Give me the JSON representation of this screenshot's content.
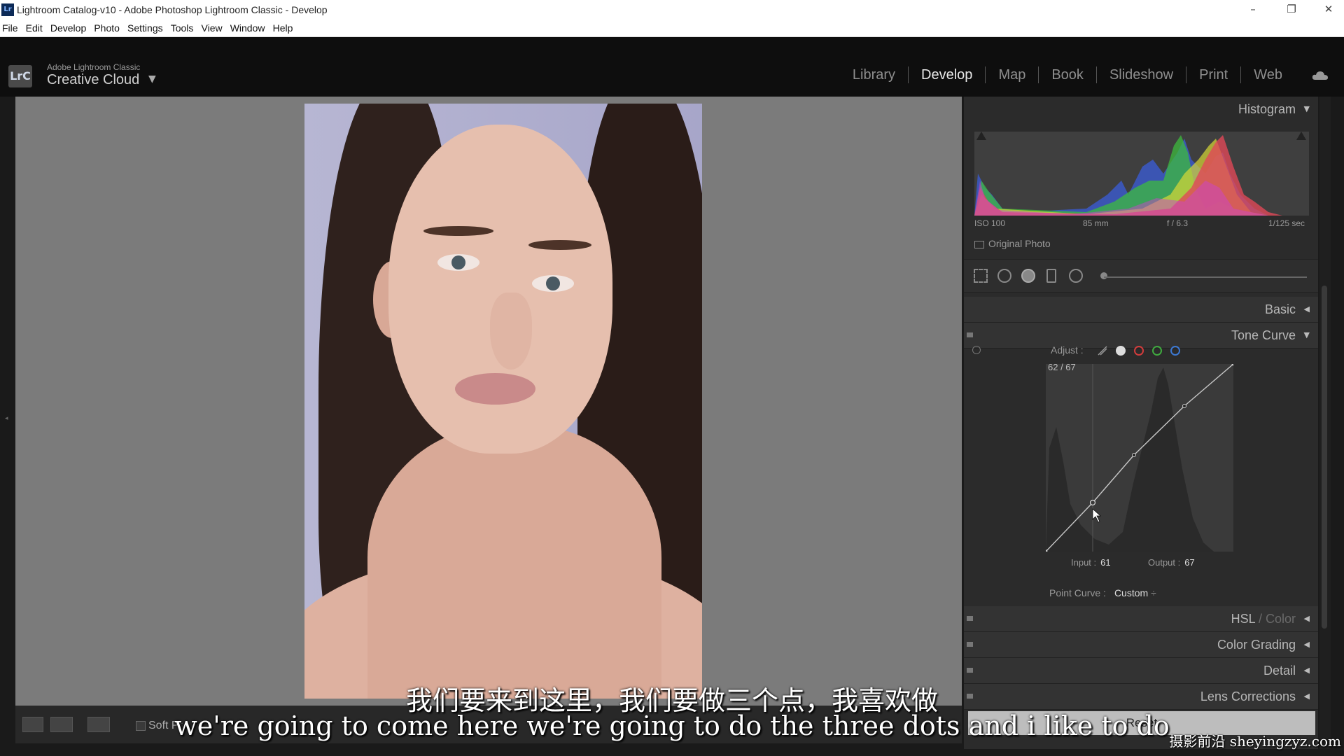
{
  "window": {
    "title": "Lightroom Catalog-v10 - Adobe Photoshop Lightroom Classic - Develop",
    "app_icon_text": "Lr",
    "controls": [
      "–",
      "❐",
      "✕"
    ]
  },
  "menu": [
    "File",
    "Edit",
    "Develop",
    "Photo",
    "Settings",
    "Tools",
    "View",
    "Window",
    "Help"
  ],
  "brand": {
    "logo_text": "LrC",
    "product": "Adobe Lightroom Classic",
    "identity": "Creative Cloud",
    "caret": "▼"
  },
  "modules": [
    "Library",
    "Develop",
    "Map",
    "Book",
    "Slideshow",
    "Print",
    "Web"
  ],
  "active_module": "Develop",
  "toolbar": {
    "soft_proofing_label": "Soft Pr"
  },
  "right_panel": {
    "histogram": {
      "title": "Histogram",
      "iso": "ISO 100",
      "focal": "85 mm",
      "aperture": "f / 6.3",
      "shutter": "1/125 sec",
      "original_photo_label": "Original Photo"
    },
    "sections": {
      "basic": "Basic",
      "tone_curve": "Tone Curve",
      "hsl_a": "HSL",
      "hsl_sep": " / ",
      "hsl_b": "Color",
      "color_grading": "Color Grading",
      "detail": "Detail",
      "lens_corrections": "Lens Corrections"
    },
    "tone_curve": {
      "adjust_label": "Adjust :",
      "readout": "62 / 67",
      "input_label": "Input :",
      "input_value": "61",
      "output_label": "Output :",
      "output_value": "67",
      "point_curve_label": "Point Curve :",
      "point_curve_value": "Custom",
      "point_curve_caret": "÷",
      "channel_colors": [
        "#d9d9d9",
        "#d23c3c",
        "#3faa3f",
        "#3c78d2"
      ]
    },
    "reset_label": "Reset"
  },
  "subtitles": {
    "chinese": "我们要来到这里，我们要做三个点，我喜欢做",
    "english": "we're going to come here we're going to do the three dots and i like to do"
  },
  "watermark": "摄影前沿 sheyingzyz.com"
}
